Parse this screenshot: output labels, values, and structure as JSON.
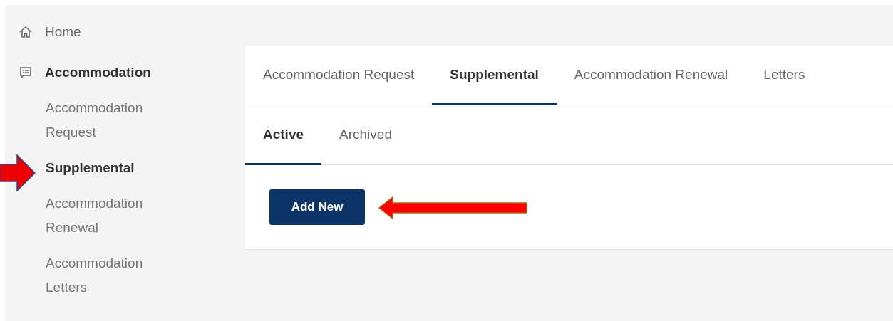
{
  "sidebar": {
    "items": [
      {
        "kind": "home",
        "label": "Home",
        "selected": false
      },
      {
        "kind": "section",
        "label": "Accommodation",
        "expanded": true,
        "children": [
          {
            "label": "Accommodation Request",
            "selected": false
          },
          {
            "label": "Supplemental",
            "selected": true
          },
          {
            "label": "Accommodation Renewal",
            "selected": false
          },
          {
            "label": "Accommodation Letters",
            "selected": false
          }
        ]
      }
    ]
  },
  "tabs": [
    {
      "label": "Accommodation Request",
      "selected": false
    },
    {
      "label": "Supplemental",
      "selected": true
    },
    {
      "label": "Accommodation Renewal",
      "selected": false
    },
    {
      "label": "Letters",
      "selected": false
    }
  ],
  "subtabs": [
    {
      "label": "Active",
      "selected": true
    },
    {
      "label": "Archived",
      "selected": false
    }
  ],
  "add_button": {
    "label": "Add New"
  }
}
